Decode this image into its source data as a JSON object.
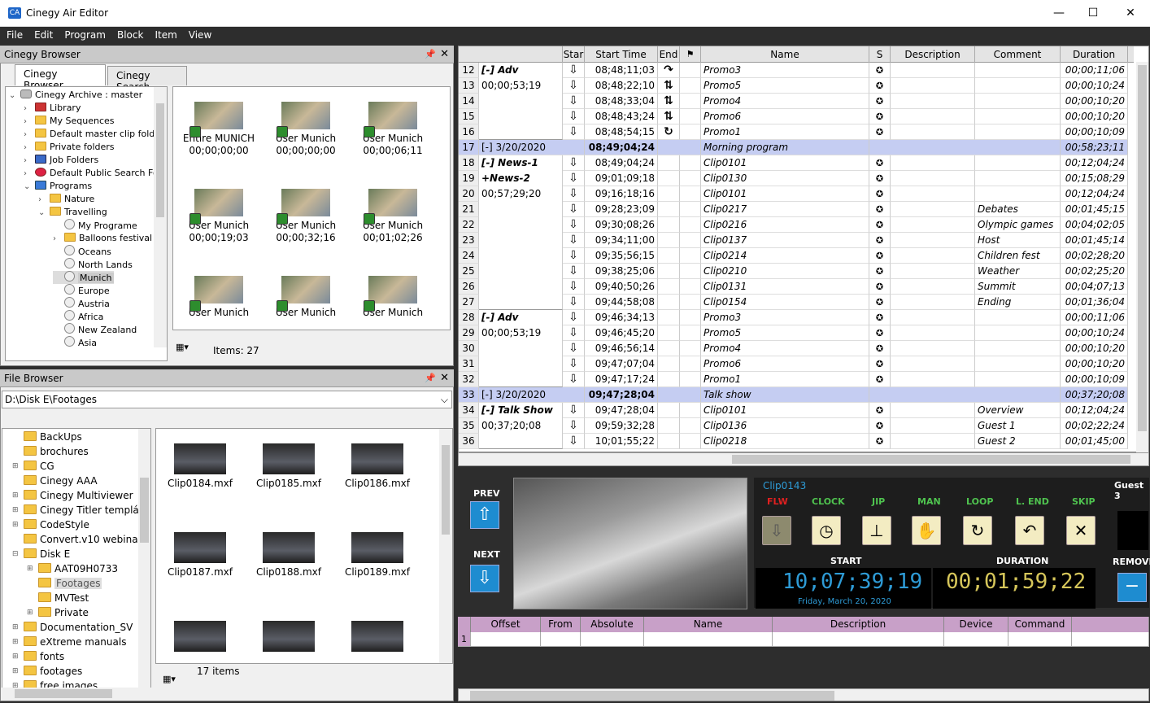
{
  "app": {
    "title": "Cinegy Air Editor"
  },
  "window": {
    "minimize": "—",
    "maximize": "☐",
    "close": "✕"
  },
  "menu": [
    "File",
    "Edit",
    "Program",
    "Block",
    "Item",
    "View"
  ],
  "browser": {
    "title": "Cinegy Browser",
    "tabs": [
      "Cinegy Browser",
      "Cinegy Search"
    ],
    "tree": [
      {
        "label": "Cinegy Archive : master",
        "indent": 0,
        "exp": "v",
        "icon": "db"
      },
      {
        "label": "Library",
        "indent": 1,
        "exp": ">",
        "icon": "lib"
      },
      {
        "label": "My Sequences",
        "indent": 1,
        "exp": ">",
        "icon": "folder"
      },
      {
        "label": "Default master clip folder",
        "indent": 1,
        "exp": ">",
        "icon": "folder"
      },
      {
        "label": "Private folders",
        "indent": 1,
        "exp": ">",
        "icon": "folder"
      },
      {
        "label": "Job Folders",
        "indent": 1,
        "exp": ">",
        "icon": "job"
      },
      {
        "label": "Default Public Search Fol",
        "indent": 1,
        "exp": ">",
        "icon": "search"
      },
      {
        "label": "Programs",
        "indent": 1,
        "exp": "v",
        "icon": "prog"
      },
      {
        "label": "Nature",
        "indent": 2,
        "exp": ">",
        "icon": "folder"
      },
      {
        "label": "Travelling",
        "indent": 2,
        "exp": "v",
        "icon": "folder"
      },
      {
        "label": "My Programe",
        "indent": 3,
        "exp": "",
        "icon": "globe"
      },
      {
        "label": "Balloons festival",
        "indent": 3,
        "exp": ">",
        "icon": "folder"
      },
      {
        "label": "Oceans",
        "indent": 3,
        "exp": "",
        "icon": "globe"
      },
      {
        "label": "North Lands",
        "indent": 3,
        "exp": "",
        "icon": "globe"
      },
      {
        "label": "Munich",
        "indent": 3,
        "exp": "",
        "icon": "globe",
        "sel": true
      },
      {
        "label": "Europe",
        "indent": 3,
        "exp": "",
        "icon": "globe"
      },
      {
        "label": "Austria",
        "indent": 3,
        "exp": "",
        "icon": "globe"
      },
      {
        "label": "Africa",
        "indent": 3,
        "exp": "",
        "icon": "globe"
      },
      {
        "label": "New Zealand",
        "indent": 3,
        "exp": "",
        "icon": "globe"
      },
      {
        "label": "Asia",
        "indent": 3,
        "exp": "",
        "icon": "globe"
      }
    ],
    "thumbs": [
      {
        "name": "Entire MUNICH",
        "tc": "00;00;00;00"
      },
      {
        "name": "User Munich",
        "tc": "00;00;00;00"
      },
      {
        "name": "User Munich",
        "tc": "00;00;06;11"
      },
      {
        "name": "User Munich",
        "tc": "00;00;19;03"
      },
      {
        "name": "User Munich",
        "tc": "00;00;32;16"
      },
      {
        "name": "User Munich",
        "tc": "00;01;02;26"
      },
      {
        "name": "User Munich",
        "tc": ""
      },
      {
        "name": "User Munich",
        "tc": ""
      },
      {
        "name": "User Munich",
        "tc": ""
      }
    ],
    "items": "Items: 27"
  },
  "files": {
    "title": "File Browser",
    "path": "D:\\Disk E\\Footages",
    "tree": [
      {
        "label": "BackUps",
        "indent": 0
      },
      {
        "label": "brochures",
        "indent": 0
      },
      {
        "label": "CG",
        "indent": 0,
        "exp": "+"
      },
      {
        "label": "Cinegy AAA",
        "indent": 0
      },
      {
        "label": "Cinegy Multiviewer",
        "indent": 0,
        "exp": "+"
      },
      {
        "label": "Cinegy Titler templá",
        "indent": 0,
        "exp": "+"
      },
      {
        "label": "CodeStyle",
        "indent": 0,
        "exp": "+"
      },
      {
        "label": "Convert.v10 webina",
        "indent": 0
      },
      {
        "label": "Disk E",
        "indent": 0,
        "exp": "-"
      },
      {
        "label": "AAT09H0733",
        "indent": 1,
        "exp": "+"
      },
      {
        "label": "Footages",
        "indent": 1,
        "sel": true
      },
      {
        "label": "MVTest",
        "indent": 1
      },
      {
        "label": "Private",
        "indent": 1,
        "exp": "+"
      },
      {
        "label": "Documentation_SV",
        "indent": 0,
        "exp": "+"
      },
      {
        "label": "eXtreme manuals",
        "indent": 0,
        "exp": "+"
      },
      {
        "label": "fonts",
        "indent": 0,
        "exp": "+"
      },
      {
        "label": "footages",
        "indent": 0,
        "exp": "+"
      },
      {
        "label": "free images",
        "indent": 0,
        "exp": "+"
      }
    ],
    "thumbs": [
      "Clip0184.mxf",
      "Clip0185.mxf",
      "Clip0186.mxf",
      "Clip0187.mxf",
      "Clip0188.mxf",
      "Clip0189.mxf",
      "",
      "",
      ""
    ],
    "items": "17 items"
  },
  "grid": {
    "headers": [
      "Star",
      "Start Time",
      "End",
      "",
      "Name",
      "S",
      "Description",
      "Comment",
      "Duration"
    ],
    "groups": [
      {
        "first": 12,
        "count": 5,
        "l1": "[-] Adv",
        "l2": "00;00;53;19"
      },
      {
        "first": 18,
        "count": 10,
        "l1": "[-] News-1",
        "l1b": "+News-2",
        "l2": "00;57;29;20"
      },
      {
        "first": 28,
        "count": 5,
        "l1": "[-] Adv",
        "l2": "00;00;53;19"
      },
      {
        "first": 34,
        "count": 3,
        "l1": "[-] Talk Show",
        "l2": "00;37;20;08"
      }
    ],
    "rows": [
      {
        "n": "12",
        "star": "⇩",
        "start": "08;48;11;03",
        "end": "↷",
        "name": "Promo3",
        "s": "✪",
        "desc": "",
        "comment": "",
        "dur": "00;00;11;06"
      },
      {
        "n": "13",
        "star": "⇩",
        "start": "08;48;22;10",
        "end": "⇅",
        "name": "Promo5",
        "s": "✪",
        "desc": "",
        "comment": "",
        "dur": "00;00;10;24"
      },
      {
        "n": "14",
        "star": "⇩",
        "start": "08;48;33;04",
        "end": "⇅",
        "name": "Promo4",
        "s": "✪",
        "desc": "",
        "comment": "",
        "dur": "00;00;10;20"
      },
      {
        "n": "15",
        "star": "⇩",
        "start": "08;48;43;24",
        "end": "⇅",
        "name": "Promo6",
        "s": "✪",
        "desc": "",
        "comment": "",
        "dur": "00;00;10;20"
      },
      {
        "n": "16",
        "star": "⇩",
        "start": "08;48;54;15",
        "end": "↻",
        "name": "Promo1",
        "s": "✪",
        "desc": "",
        "comment": "",
        "dur": "00;00;10;09"
      },
      {
        "n": "17",
        "block": true,
        "label": "[-] 3/20/2020",
        "start": "08;49;04;24",
        "name": "Morning program",
        "dur": "00;58;23;11"
      },
      {
        "n": "18",
        "star": "⇩",
        "start": "08;49;04;24",
        "end": "",
        "name": "Clip0101",
        "s": "✪",
        "desc": "",
        "comment": "",
        "dur": "00;12;04;24"
      },
      {
        "n": "19",
        "star": "⇩",
        "start": "09;01;09;18",
        "end": "",
        "name": "Clip0130",
        "s": "✪",
        "desc": "",
        "comment": "",
        "dur": "00;15;08;29"
      },
      {
        "n": "20",
        "star": "⇩",
        "start": "09;16;18;16",
        "end": "",
        "name": "Clip0101",
        "s": "✪",
        "desc": "",
        "comment": "",
        "dur": "00;12;04;24"
      },
      {
        "n": "21",
        "star": "⇩",
        "start": "09;28;23;09",
        "end": "",
        "name": "Clip0217",
        "s": "✪",
        "desc": "",
        "comment": "Debates",
        "dur": "00;01;45;15"
      },
      {
        "n": "22",
        "star": "⇩",
        "start": "09;30;08;26",
        "end": "",
        "name": "Clip0216",
        "s": "✪",
        "desc": "",
        "comment": "Olympic games",
        "dur": "00;04;02;05"
      },
      {
        "n": "23",
        "star": "⇩",
        "start": "09;34;11;00",
        "end": "",
        "name": "Clip0137",
        "s": "✪",
        "desc": "",
        "comment": "Host",
        "dur": "00;01;45;14"
      },
      {
        "n": "24",
        "star": "⇩",
        "start": "09;35;56;15",
        "end": "",
        "name": "Clip0214",
        "s": "✪",
        "desc": "",
        "comment": "Children fest",
        "dur": "00;02;28;20"
      },
      {
        "n": "25",
        "star": "⇩",
        "start": "09;38;25;06",
        "end": "",
        "name": "Clip0210",
        "s": "✪",
        "desc": "",
        "comment": "Weather",
        "dur": "00;02;25;20"
      },
      {
        "n": "26",
        "star": "⇩",
        "start": "09;40;50;26",
        "end": "",
        "name": "Clip0131",
        "s": "✪",
        "desc": "",
        "comment": "Summit",
        "dur": "00;04;07;13"
      },
      {
        "n": "27",
        "star": "⇩",
        "start": "09;44;58;08",
        "end": "",
        "name": "Clip0154",
        "s": "✪",
        "desc": "",
        "comment": "Ending",
        "dur": "00;01;36;04"
      },
      {
        "n": "28",
        "star": "⇩",
        "start": "09;46;34;13",
        "end": "",
        "name": "Promo3",
        "s": "✪",
        "desc": "",
        "comment": "",
        "dur": "00;00;11;06"
      },
      {
        "n": "29",
        "star": "⇩",
        "start": "09;46;45;20",
        "end": "",
        "name": "Promo5",
        "s": "✪",
        "desc": "",
        "comment": "",
        "dur": "00;00;10;24"
      },
      {
        "n": "30",
        "star": "⇩",
        "start": "09;46;56;14",
        "end": "",
        "name": "Promo4",
        "s": "✪",
        "desc": "",
        "comment": "",
        "dur": "00;00;10;20"
      },
      {
        "n": "31",
        "star": "⇩",
        "start": "09;47;07;04",
        "end": "",
        "name": "Promo6",
        "s": "✪",
        "desc": "",
        "comment": "",
        "dur": "00;00;10;20"
      },
      {
        "n": "32",
        "star": "⇩",
        "start": "09;47;17;24",
        "end": "",
        "name": "Promo1",
        "s": "✪",
        "desc": "",
        "comment": "",
        "dur": "00;00;10;09"
      },
      {
        "n": "33",
        "block": true,
        "label": "[-] 3/20/2020",
        "start": "09;47;28;04",
        "name": "Talk show",
        "dur": "00;37;20;08"
      },
      {
        "n": "34",
        "star": "⇩",
        "start": "09;47;28;04",
        "end": "",
        "name": "Clip0101",
        "s": "✪",
        "desc": "",
        "comment": "Overview",
        "dur": "00;12;04;24"
      },
      {
        "n": "35",
        "star": "⇩",
        "start": "09;59;32;28",
        "end": "",
        "name": "Clip0136",
        "s": "✪",
        "desc": "",
        "comment": "Guest 1",
        "dur": "00;02;22;24"
      },
      {
        "n": "36",
        "star": "⇩",
        "start": "10;01;55;22",
        "end": "",
        "name": "Clip0218",
        "s": "✪",
        "desc": "",
        "comment": "Guest 2",
        "dur": "00;01;45;00"
      }
    ]
  },
  "player": {
    "prev": "PREV",
    "next": "NEXT",
    "remove": "REMOVE",
    "clip": "Clip0143",
    "next_item": "Guest 3",
    "flags": [
      "FLW",
      "CLOCK",
      "JIP",
      "MAN",
      "LOOP",
      "L. END",
      "SKIP"
    ],
    "start_label": "START",
    "duration_label": "DURATION",
    "start_tc": "10;07;39;19",
    "duration_tc": "00;01;59;22",
    "date": "Friday, March 20, 2020"
  },
  "events": {
    "headers": [
      "Offset",
      "From",
      "Absolute",
      "Name",
      "Description",
      "Device",
      "Command"
    ],
    "row": "1"
  },
  "colors": {
    "accent": "#1e8cd0",
    "block": "#c5cdf2",
    "tc_start": "#2e9bd6",
    "tc_dur": "#d6c65a",
    "flag": "#4fc34f",
    "flag_off": "#e02020"
  }
}
